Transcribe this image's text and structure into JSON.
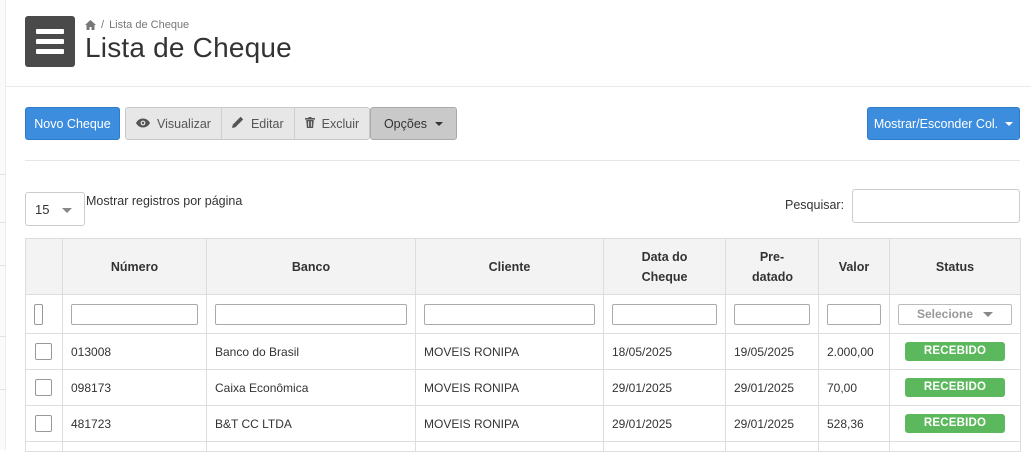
{
  "header": {
    "breadcrumb": "Lista de Cheque",
    "title": "Lista de Cheque"
  },
  "toolbar": {
    "new_label": "Novo Cheque",
    "view_label": "Visualizar",
    "edit_label": "Editar",
    "delete_label": "Excluir",
    "options_label": "Opções",
    "columns_label": "Mostrar/Esconder Col."
  },
  "controls": {
    "page_length": "15",
    "page_length_label": "Mostrar registros por página",
    "search_label": "Pesquisar:"
  },
  "table": {
    "columns": [
      "Número",
      "Banco",
      "Cliente",
      "Data do Cheque",
      "Pre-datado",
      "Valor",
      "Status"
    ],
    "status_filter": "Selecione",
    "rows": [
      {
        "numero": "013008",
        "banco": "Banco do Brasil",
        "cliente": "MOVEIS RONIPA",
        "data": "18/05/2025",
        "predatado": "19/05/2025",
        "valor": "2.000,00",
        "status": "RECEBIDO"
      },
      {
        "numero": "098173",
        "banco": "Caixa Econômica",
        "cliente": "MOVEIS RONIPA",
        "data": "29/01/2025",
        "predatado": "29/01/2025",
        "valor": "70,00",
        "status": "RECEBIDO"
      },
      {
        "numero": "481723",
        "banco": "B&T CC LTDA",
        "cliente": "MOVEIS RONIPA",
        "data": "29/01/2025",
        "predatado": "29/01/2025",
        "valor": "528,36",
        "status": "RECEBIDO"
      }
    ]
  },
  "colors": {
    "primary": "#3c8dde",
    "status_received": "#5cb85c",
    "menu_bg": "#4a4a4a"
  },
  "icons": [
    "menu-icon",
    "home-icon",
    "eye-icon",
    "pencil-icon",
    "trash-icon",
    "caret-down-icon"
  ]
}
